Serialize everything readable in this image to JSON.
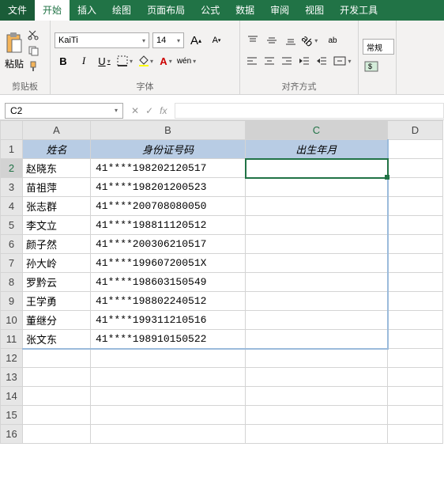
{
  "menu": {
    "file": "文件",
    "home": "开始",
    "insert": "插入",
    "draw": "绘图",
    "layout": "页面布局",
    "formula": "公式",
    "data": "数据",
    "review": "审阅",
    "view": "视图",
    "dev": "开发工具"
  },
  "ribbon": {
    "clipboard": {
      "label": "剪贴板",
      "paste": "粘贴"
    },
    "font": {
      "label": "字体",
      "name": "KaiTi",
      "size": "14",
      "b": "B",
      "i": "I",
      "u": "U",
      "wen": "wén"
    },
    "align": {
      "label": "对齐方式",
      "wrap": "ab"
    },
    "number": {
      "label": "",
      "general": "常规"
    }
  },
  "formula_bar": {
    "namebox": "C2",
    "fx": "fx"
  },
  "cols": [
    "A",
    "B",
    "C",
    "D"
  ],
  "headers": {
    "a": "姓名",
    "b": "身份证号码",
    "c": "出生年月"
  },
  "rows": [
    {
      "n": "赵晓东",
      "id": "41****198202120517"
    },
    {
      "n": "苗祖萍",
      "id": "41****198201200523"
    },
    {
      "n": "张志群",
      "id": "41****200708080050"
    },
    {
      "n": "李文立",
      "id": "41****198811120512"
    },
    {
      "n": "颜子然",
      "id": "41****200306210517"
    },
    {
      "n": "孙大岭",
      "id": "41****19960720051X"
    },
    {
      "n": "罗黔云",
      "id": "41****198603150549"
    },
    {
      "n": "王学勇",
      "id": "41****198802240512"
    },
    {
      "n": "董继分",
      "id": "41****199311210516"
    },
    {
      "n": "张文东",
      "id": "41****198910150522"
    }
  ]
}
